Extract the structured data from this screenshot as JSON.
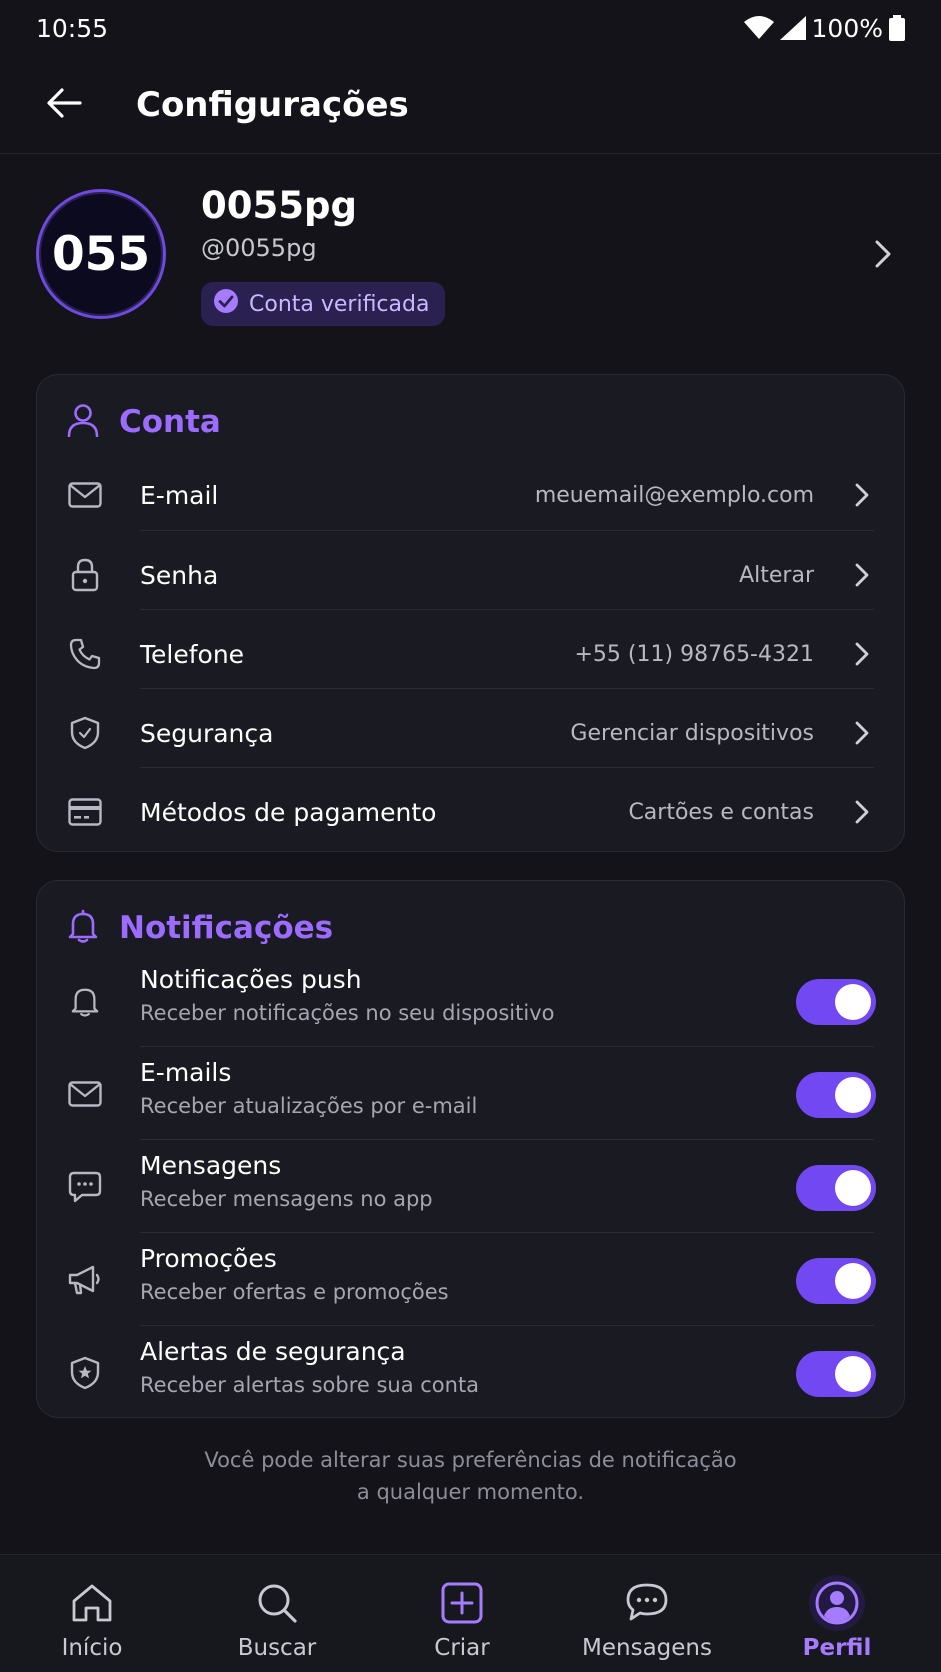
{
  "status_bar": {
    "time": "10:55",
    "battery": "100%"
  },
  "app_bar": {
    "title": "Configurações"
  },
  "profile": {
    "avatar_text": "055",
    "name": "0055pg",
    "handle": "@0055pg",
    "badge": "Conta verificada"
  },
  "account": {
    "title": "Conta",
    "rows": [
      {
        "label": "E-mail",
        "value": "meuemail@exemplo.com",
        "icon": "mail-icon"
      },
      {
        "label": "Senha",
        "value": "Alterar",
        "icon": "lock-icon"
      },
      {
        "label": "Telefone",
        "value": "+55 (11) 98765-4321",
        "icon": "phone-icon"
      },
      {
        "label": "Segurança",
        "value": "Gerenciar dispositivos",
        "icon": "shield-icon"
      },
      {
        "label": "Métodos de pagamento",
        "value": "Cartões e contas",
        "icon": "card-icon"
      }
    ]
  },
  "notifications": {
    "title": "Notificações",
    "rows": [
      {
        "title": "Notificações push",
        "subtitle": "Receber notificações no seu dispositivo",
        "enabled": true,
        "icon": "bell-icon"
      },
      {
        "title": "E-mails",
        "subtitle": "Receber atualizações por e-mail",
        "enabled": true,
        "icon": "mail-icon"
      },
      {
        "title": "Mensagens",
        "subtitle": "Receber mensagens no app",
        "enabled": true,
        "icon": "chat-icon"
      },
      {
        "title": "Promoções",
        "subtitle": "Receber ofertas e promoções",
        "enabled": true,
        "icon": "megaphone-icon"
      },
      {
        "title": "Alertas de segurança",
        "subtitle": "Receber alertas sobre sua conta",
        "enabled": true,
        "icon": "shield-star-icon"
      }
    ]
  },
  "footnote": {
    "line1": "Você pode alterar suas preferências de notificação",
    "line2": "a qualquer momento."
  },
  "bottom_nav": {
    "items": [
      {
        "label": "Início",
        "icon": "home-icon",
        "active": false
      },
      {
        "label": "Buscar",
        "icon": "search-icon",
        "active": false
      },
      {
        "label": "Criar",
        "icon": "plus-square-icon",
        "active": false
      },
      {
        "label": "Mensagens",
        "icon": "chat-icon",
        "active": false
      },
      {
        "label": "Perfil",
        "icon": "profile-icon",
        "active": true
      }
    ]
  },
  "colors": {
    "background": "#131319",
    "card": "#1a1a22",
    "accent": "#7148f2",
    "accent_text": "#9b6cff"
  }
}
